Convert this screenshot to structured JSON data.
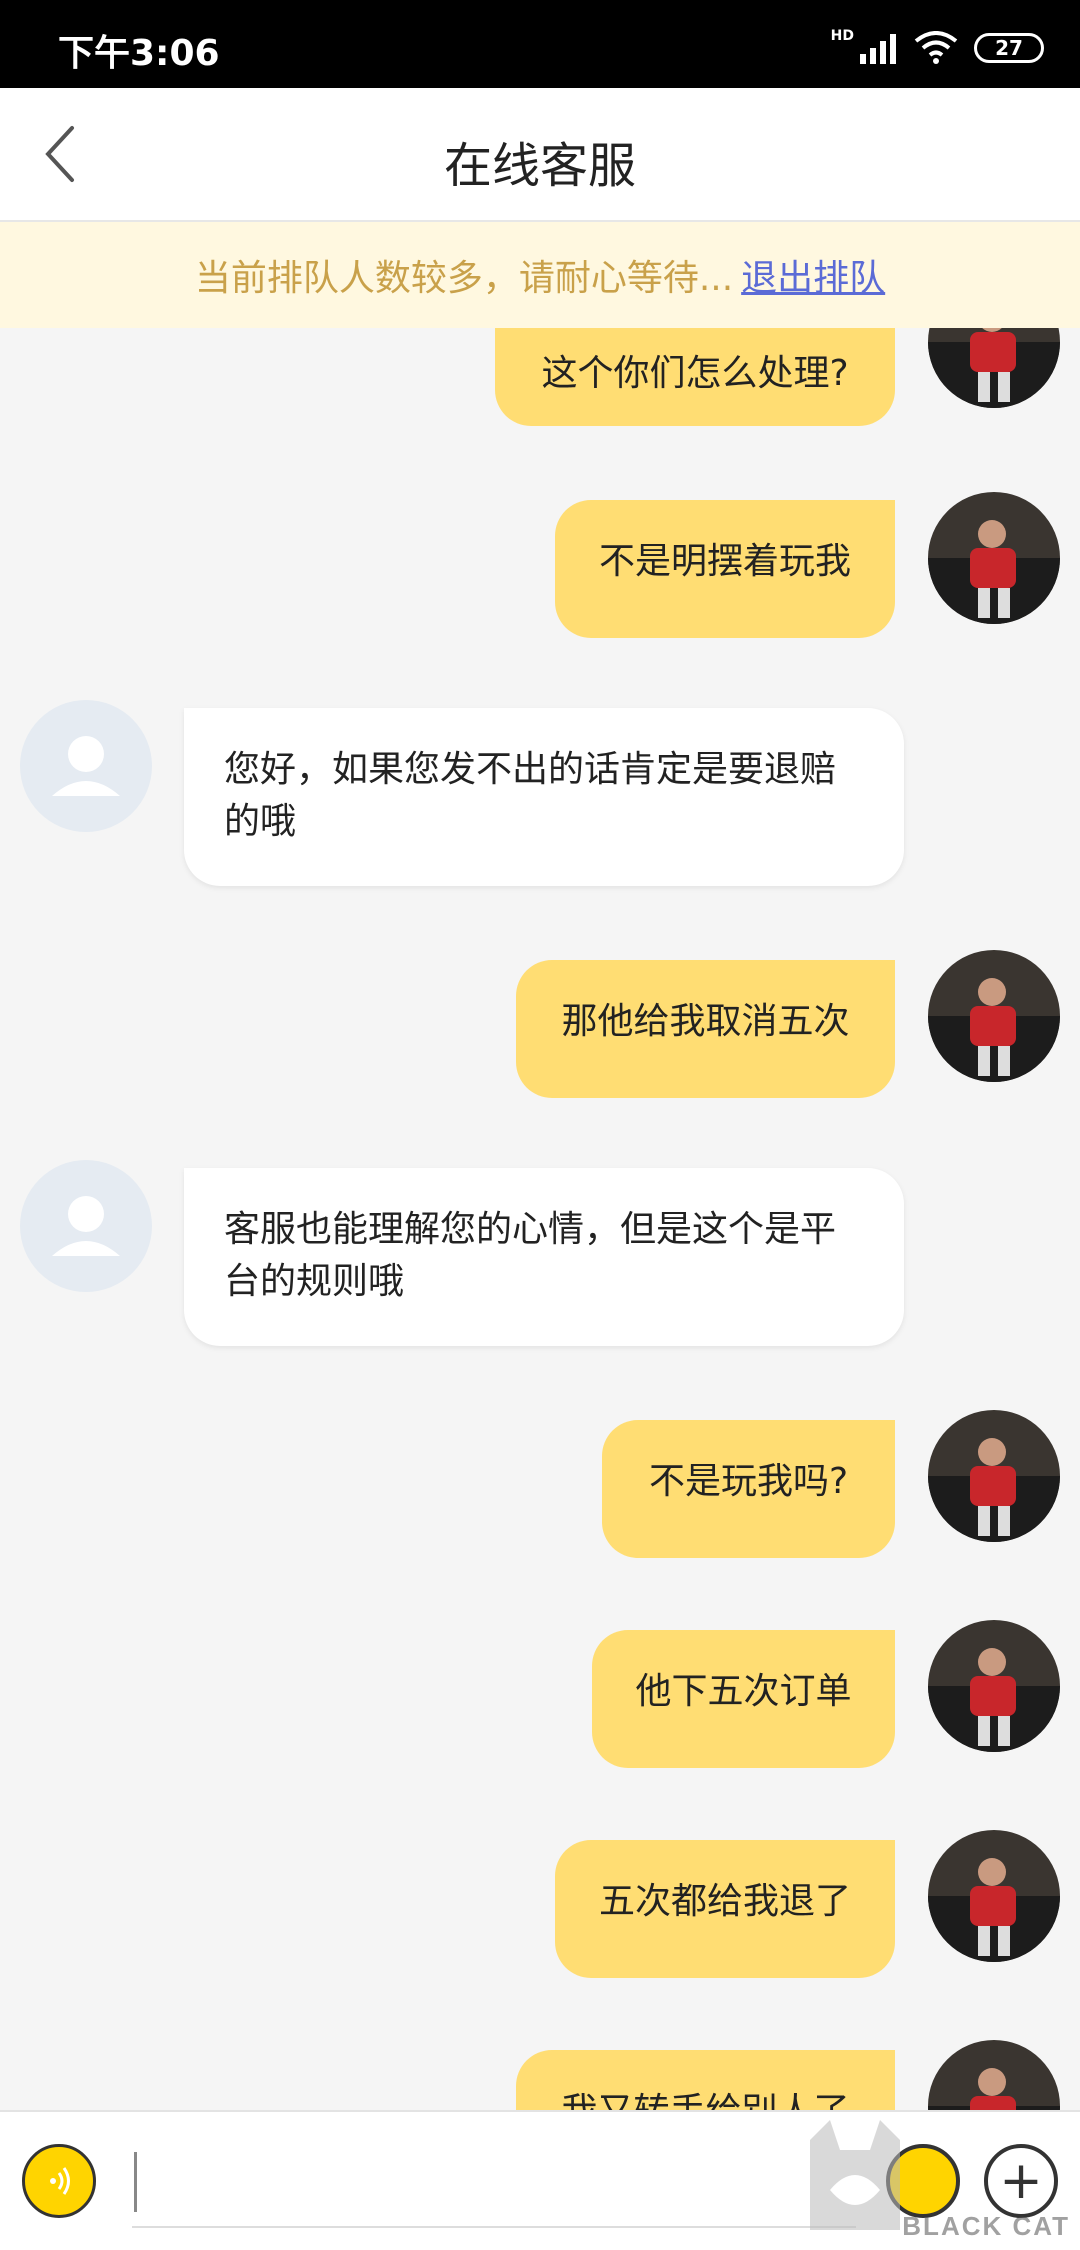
{
  "status": {
    "time": "下午3:06",
    "hd": "HD",
    "battery": "27"
  },
  "header": {
    "title": "在线客服"
  },
  "queue": {
    "text": "当前排队人数较多，请耐心等待...",
    "exit": "退出排队"
  },
  "messages": [
    {
      "from": "user",
      "text": "这个你们怎么处理?"
    },
    {
      "from": "user",
      "text": "不是明摆着玩我"
    },
    {
      "from": "agent",
      "text": "您好，如果您发不出的话肯定是要退赔的哦"
    },
    {
      "from": "user",
      "text": "那他给我取消五次"
    },
    {
      "from": "agent",
      "text": "客服也能理解您的心情，但是这个是平台的规则哦"
    },
    {
      "from": "user",
      "text": "不是玩我吗?"
    },
    {
      "from": "user",
      "text": "他下五次订单"
    },
    {
      "from": "user",
      "text": "五次都给我退了"
    },
    {
      "from": "user",
      "text": "我又转手给别人了"
    }
  ],
  "input": {
    "placeholder": ""
  },
  "watermark": {
    "text": "BLACK CAT"
  },
  "colors": {
    "user_bubble": "#ffdd73",
    "agent_bubble": "#ffffff",
    "queue_bg": "#fff8e0",
    "queue_text": "#c9a14a",
    "link": "#5b6bd6"
  }
}
